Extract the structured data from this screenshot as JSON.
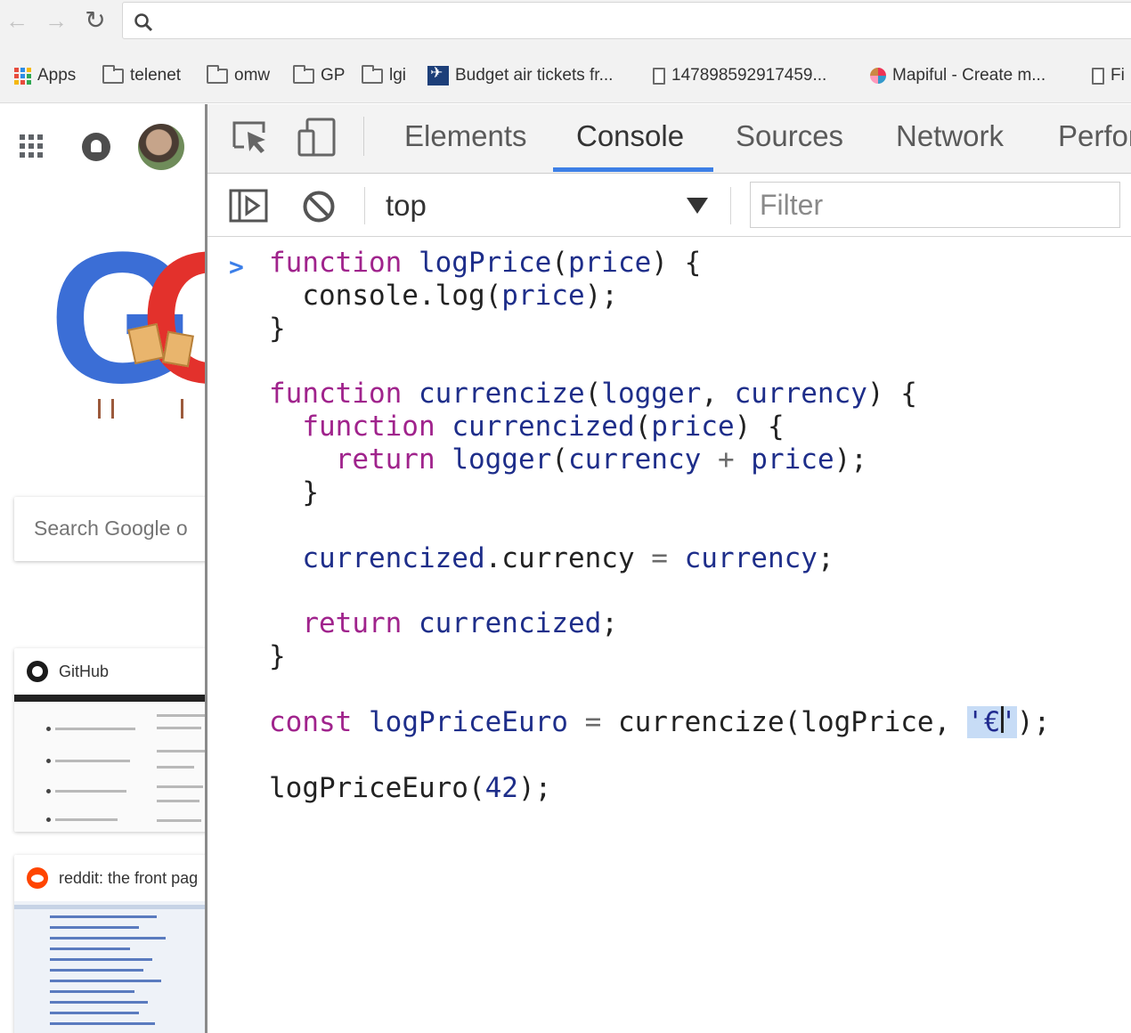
{
  "browser": {
    "bookmarks": [
      {
        "label": "Apps",
        "icon": "apps-grid-icon"
      },
      {
        "label": "telenet",
        "icon": "folder-icon"
      },
      {
        "label": "omw",
        "icon": "folder-icon"
      },
      {
        "label": "GP",
        "icon": "folder-icon"
      },
      {
        "label": "lgi",
        "icon": "folder-icon"
      },
      {
        "label": "Budget air tickets fr...",
        "icon": "plane-favicon"
      },
      {
        "label": "147898592917459...",
        "icon": "page-icon"
      },
      {
        "label": "Mapiful - Create m...",
        "icon": "mapiful-favicon"
      },
      {
        "label": "Fi",
        "icon": "page-icon"
      }
    ]
  },
  "google_page": {
    "search_placeholder": "Search Google o",
    "tiles": [
      {
        "title": "GitHub",
        "icon": "github-icon"
      },
      {
        "title": "reddit: the front pag",
        "icon": "reddit-icon"
      }
    ]
  },
  "devtools": {
    "tabs": [
      {
        "label": "Elements",
        "active": false
      },
      {
        "label": "Console",
        "active": true
      },
      {
        "label": "Sources",
        "active": false
      },
      {
        "label": "Network",
        "active": false
      },
      {
        "label": "Perfor",
        "active": false
      }
    ],
    "context": "top",
    "filter_placeholder": "Filter",
    "accent_color": "#3d7fe6",
    "prompt_symbol": ">",
    "code_lines": [
      [
        {
          "t": "function",
          "c": "kw"
        },
        {
          "t": " "
        },
        {
          "t": "logPrice",
          "c": "vn"
        },
        {
          "t": "("
        },
        {
          "t": "price",
          "c": "vn"
        },
        {
          "t": ") {"
        }
      ],
      [
        {
          "t": "  console.log("
        },
        {
          "t": "price",
          "c": "vn"
        },
        {
          "t": ");"
        }
      ],
      [
        {
          "t": "}"
        }
      ],
      [
        {
          "t": "function",
          "c": "kw"
        },
        {
          "t": " "
        },
        {
          "t": "currencize",
          "c": "vn"
        },
        {
          "t": "("
        },
        {
          "t": "logger",
          "c": "vn"
        },
        {
          "t": ", "
        },
        {
          "t": "currency",
          "c": "vn"
        },
        {
          "t": ") {"
        }
      ],
      [
        {
          "t": "  "
        },
        {
          "t": "function",
          "c": "kw"
        },
        {
          "t": " "
        },
        {
          "t": "currencized",
          "c": "vn"
        },
        {
          "t": "("
        },
        {
          "t": "price",
          "c": "vn"
        },
        {
          "t": ") {"
        }
      ],
      [
        {
          "t": "    "
        },
        {
          "t": "return",
          "c": "kw"
        },
        {
          "t": " "
        },
        {
          "t": "logger",
          "c": "vn"
        },
        {
          "t": "("
        },
        {
          "t": "currency",
          "c": "vn"
        },
        {
          "t": " "
        },
        {
          "t": "+",
          "c": "op"
        },
        {
          "t": " "
        },
        {
          "t": "price",
          "c": "vn"
        },
        {
          "t": ");"
        }
      ],
      [
        {
          "t": "  }"
        }
      ],
      [
        {
          "t": "  "
        },
        {
          "t": "currencized",
          "c": "vn"
        },
        {
          "t": ".currency "
        },
        {
          "t": "=",
          "c": "op"
        },
        {
          "t": " "
        },
        {
          "t": "currency",
          "c": "vn"
        },
        {
          "t": ";"
        }
      ],
      [
        {
          "t": "  "
        },
        {
          "t": "return",
          "c": "kw"
        },
        {
          "t": " "
        },
        {
          "t": "currencized",
          "c": "vn"
        },
        {
          "t": ";"
        }
      ],
      [
        {
          "t": "}"
        }
      ],
      [
        {
          "t": "const",
          "c": "kw"
        },
        {
          "t": " "
        },
        {
          "t": "logPriceEuro",
          "c": "vn"
        },
        {
          "t": " "
        },
        {
          "t": "=",
          "c": "op"
        },
        {
          "t": " currencize(logPrice, "
        },
        {
          "t": "'€'",
          "c": "str"
        },
        {
          "t": ");"
        }
      ],
      [
        {
          "t": "logPriceEuro("
        },
        {
          "t": "42",
          "c": "num"
        },
        {
          "t": ");"
        }
      ]
    ]
  }
}
